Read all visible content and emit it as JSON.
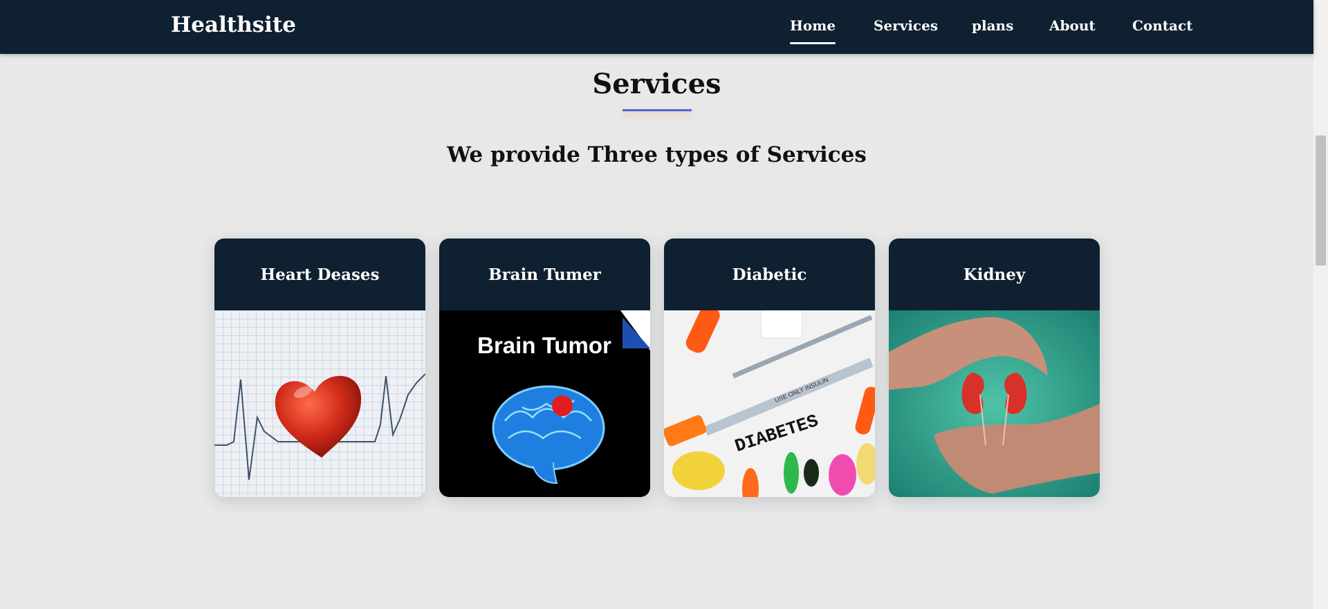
{
  "nav": {
    "brand": "Healthsite",
    "items": [
      {
        "label": "Home",
        "active": true
      },
      {
        "label": "Services"
      },
      {
        "label": "plans"
      },
      {
        "label": "About"
      },
      {
        "label": "Contact"
      }
    ]
  },
  "services": {
    "title": "Services",
    "subtitle": "We provide Three types of Services",
    "cards": [
      {
        "title": "Heart Deases"
      },
      {
        "title": "Brain Tumer",
        "image_text": "Brain Tumor"
      },
      {
        "title": "Diabetic",
        "image_text": "DIABETES",
        "small_text": "USE ONLY INSULIN"
      },
      {
        "title": "Kidney"
      }
    ]
  },
  "colors": {
    "navbar": "#0f2030",
    "background": "#e8e8e8",
    "underline": "#4a66d4"
  }
}
